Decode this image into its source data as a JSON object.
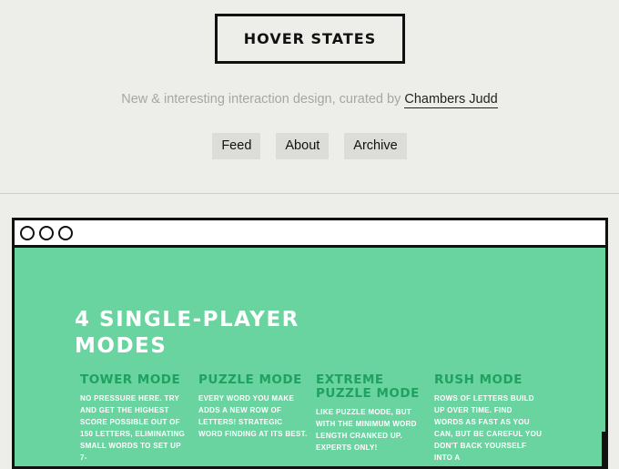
{
  "site": {
    "title": "HOVER STATES",
    "tagline_prefix": "New & interesting interaction design, curated by",
    "author_link": "Chambers Judd"
  },
  "nav": [
    "Feed",
    "About",
    "Archive"
  ],
  "preview": {
    "heading_line1": "4 SINGLE-PLAYER",
    "heading_line2": "MODES",
    "modes": [
      {
        "title": "TOWER MODE",
        "text": "NO PRESSURE HERE. TRY AND GET THE HIGHEST SCORE POSSIBLE OUT OF 150 LETTERS, ELIMINATING SMALL WORDS TO SET UP 7-"
      },
      {
        "title": "PUZZLE MODE",
        "text": "EVERY WORD YOU MAKE ADDS A NEW ROW OF LETTERS! STRATEGIC WORD FINDING AT ITS BEST."
      },
      {
        "title": "EXTREME PUZZLE MODE",
        "text": "LIKE PUZZLE MODE, BUT WITH THE MINIMUM WORD LENGTH CRANKED UP. EXPERTS ONLY!"
      },
      {
        "title": "RUSH MODE",
        "text": "ROWS OF LETTERS BUILD UP OVER TIME. FIND WORDS AS FAST AS YOU CAN, BUT BE CAREFUL YOU DON'T BACK YOURSELF INTO A"
      }
    ]
  },
  "colors": {
    "background": "#ededea",
    "preview_green": "#69d4a0",
    "mode_title_green": "#1fa15f",
    "border": "#111111"
  }
}
